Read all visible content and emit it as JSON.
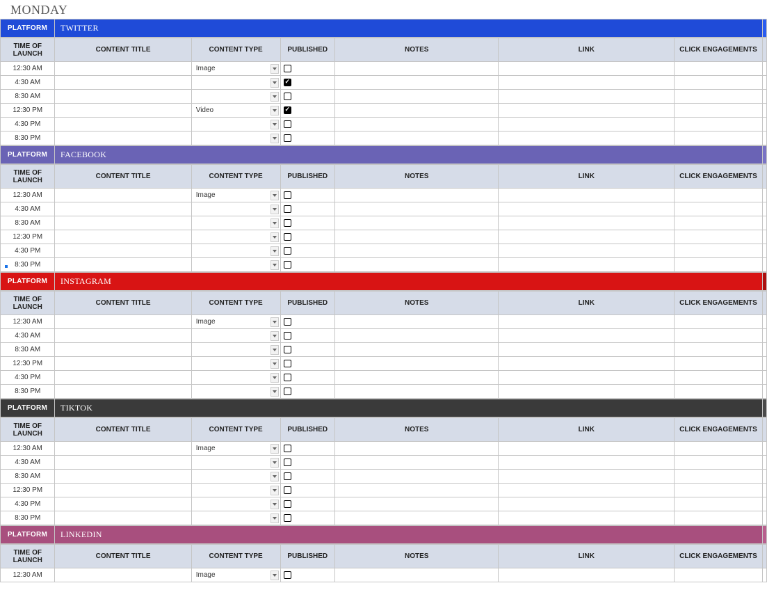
{
  "day_title": "MONDAY",
  "col_headers": {
    "time": "TIME OF LAUNCH",
    "title": "CONTENT TITLE",
    "type": "CONTENT TYPE",
    "published": "PUBLISHED",
    "notes": "NOTES",
    "link": "LINK",
    "engagements": "CLICK ENGAGEMENTS"
  },
  "platform_label": "PLATFORM",
  "sections": [
    {
      "name": "TWITTER",
      "bg": "#1f4bd8",
      "accent": "#2a5cf0",
      "rows": [
        {
          "time": "12:30 AM",
          "title": "",
          "type": "Image",
          "published": false,
          "notes": "",
          "link": "",
          "eng": ""
        },
        {
          "time": "4:30 AM",
          "title": "",
          "type": "",
          "published": true,
          "notes": "",
          "link": "",
          "eng": ""
        },
        {
          "time": "8:30 AM",
          "title": "",
          "type": "",
          "published": false,
          "notes": "",
          "link": "",
          "eng": ""
        },
        {
          "time": "12:30 PM",
          "title": "",
          "type": "Video",
          "published": true,
          "notes": "",
          "link": "",
          "eng": ""
        },
        {
          "time": "4:30 PM",
          "title": "",
          "type": "",
          "published": false,
          "notes": "",
          "link": "",
          "eng": ""
        },
        {
          "time": "8:30 PM",
          "title": "",
          "type": "",
          "published": false,
          "notes": "",
          "link": "",
          "eng": ""
        }
      ]
    },
    {
      "name": "FACEBOOK",
      "bg": "#6a63b5",
      "accent": "#7a73c5",
      "rows": [
        {
          "time": "12:30 AM",
          "title": "",
          "type": "Image",
          "published": false,
          "notes": "",
          "link": "",
          "eng": ""
        },
        {
          "time": "4:30 AM",
          "title": "",
          "type": "",
          "published": false,
          "notes": "",
          "link": "",
          "eng": ""
        },
        {
          "time": "8:30 AM",
          "title": "",
          "type": "",
          "published": false,
          "notes": "",
          "link": "",
          "eng": ""
        },
        {
          "time": "12:30 PM",
          "title": "",
          "type": "",
          "published": false,
          "notes": "",
          "link": "",
          "eng": ""
        },
        {
          "time": "4:30 PM",
          "title": "",
          "type": "",
          "published": false,
          "notes": "",
          "link": "",
          "eng": ""
        },
        {
          "time": "8:30 PM",
          "title": "",
          "type": "",
          "published": false,
          "notes": "",
          "link": "",
          "eng": ""
        }
      ]
    },
    {
      "name": "INSTAGRAM",
      "bg": "#d81414",
      "accent": "#ac1010",
      "rows": [
        {
          "time": "12:30 AM",
          "title": "",
          "type": "Image",
          "published": false,
          "notes": "",
          "link": "",
          "eng": ""
        },
        {
          "time": "4:30 AM",
          "title": "",
          "type": "",
          "published": false,
          "notes": "",
          "link": "",
          "eng": ""
        },
        {
          "time": "8:30 AM",
          "title": "",
          "type": "",
          "published": false,
          "notes": "",
          "link": "",
          "eng": ""
        },
        {
          "time": "12:30 PM",
          "title": "",
          "type": "",
          "published": false,
          "notes": "",
          "link": "",
          "eng": ""
        },
        {
          "time": "4:30 PM",
          "title": "",
          "type": "",
          "published": false,
          "notes": "",
          "link": "",
          "eng": ""
        },
        {
          "time": "8:30 PM",
          "title": "",
          "type": "",
          "published": false,
          "notes": "",
          "link": "",
          "eng": ""
        }
      ]
    },
    {
      "name": "TIKTOK",
      "bg": "#3a3a3a",
      "accent": "#4a4a4a",
      "rows": [
        {
          "time": "12:30 AM",
          "title": "",
          "type": "Image",
          "published": false,
          "notes": "",
          "link": "",
          "eng": ""
        },
        {
          "time": "4:30 AM",
          "title": "",
          "type": "",
          "published": false,
          "notes": "",
          "link": "",
          "eng": ""
        },
        {
          "time": "8:30 AM",
          "title": "",
          "type": "",
          "published": false,
          "notes": "",
          "link": "",
          "eng": ""
        },
        {
          "time": "12:30 PM",
          "title": "",
          "type": "",
          "published": false,
          "notes": "",
          "link": "",
          "eng": ""
        },
        {
          "time": "4:30 PM",
          "title": "",
          "type": "",
          "published": false,
          "notes": "",
          "link": "",
          "eng": ""
        },
        {
          "time": "8:30 PM",
          "title": "",
          "type": "",
          "published": false,
          "notes": "",
          "link": "",
          "eng": ""
        }
      ]
    },
    {
      "name": "LINKEDIN",
      "bg": "#a84f7e",
      "accent": "#b85f8e",
      "rows": [
        {
          "time": "12:30 AM",
          "title": "",
          "type": "Image",
          "published": false,
          "notes": "",
          "link": "",
          "eng": ""
        }
      ]
    }
  ]
}
